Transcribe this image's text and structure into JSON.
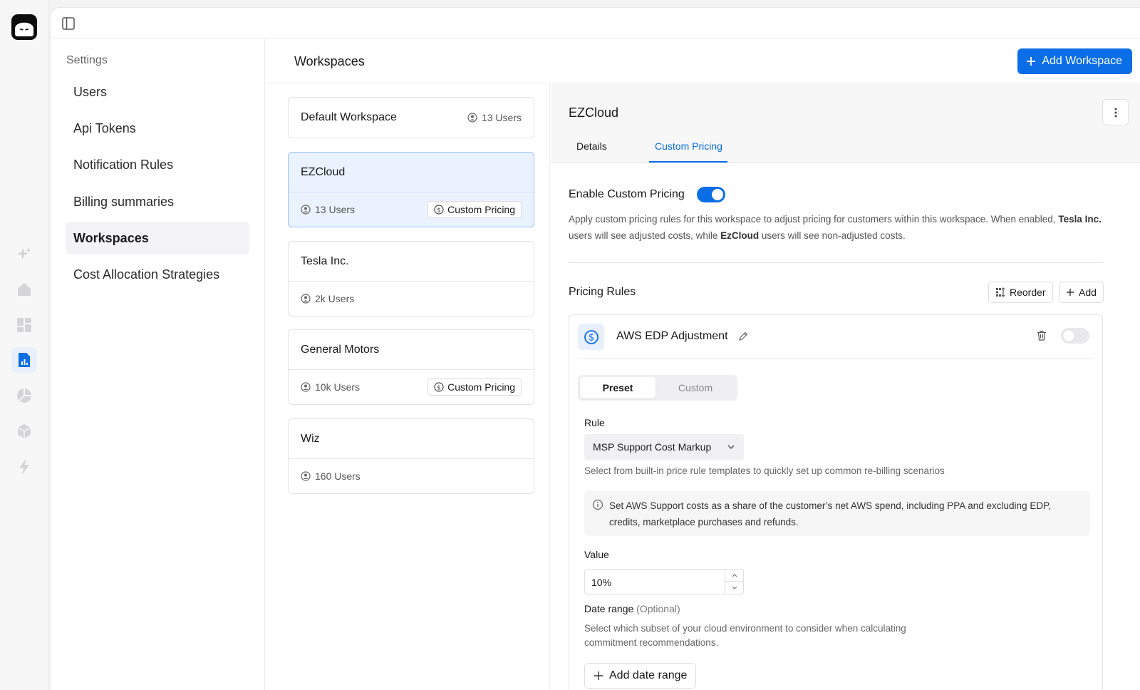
{
  "settings": {
    "title": "Settings",
    "items": [
      {
        "label": "Users"
      },
      {
        "label": "Api Tokens"
      },
      {
        "label": "Notification Rules"
      },
      {
        "label": "Billing summaries"
      },
      {
        "label": "Workspaces",
        "active": true
      },
      {
        "label": "Cost Allocation Strategies"
      }
    ]
  },
  "header": {
    "title": "Workspaces",
    "add_button": "Add Workspace"
  },
  "workspaces": [
    {
      "name": "Default Workspace",
      "users": "13 Users"
    },
    {
      "name": "EZCloud",
      "users": "13 Users",
      "badge": "Custom Pricing",
      "selected": true
    },
    {
      "name": "Tesla Inc.",
      "users": "2k Users"
    },
    {
      "name": "General Motors",
      "users": "10k Users",
      "badge": "Custom Pricing"
    },
    {
      "name": "Wiz",
      "users": "160 Users"
    }
  ],
  "detail": {
    "name": "EZCloud",
    "tabs": [
      {
        "label": "Details"
      },
      {
        "label": "Custom Pricing",
        "active": true
      }
    ],
    "enable_label": "Enable Custom Pricing",
    "enable_on": true,
    "desc_1": "Apply custom pricing rules for this workspace to adjust pricing for customers within this workspace. When enabled,",
    "desc_company": "Tesla Inc.",
    "desc_2": " users will see adjusted costs, while ",
    "desc_workspace": "EzCloud",
    "desc_3": " users will see non-adjusted costs.",
    "rules_label": "Pricing Rules",
    "reorder_label": "Reorder",
    "add_label": "Add",
    "rule": {
      "name": "AWS EDP Adjustment",
      "enabled": false,
      "seg": {
        "preset": "Preset",
        "custom": "Custom"
      },
      "rule_label": "Rule",
      "rule_value": "MSP Support Cost Markup",
      "rule_helper": "Select from built-in price rule templates to quickly set up common re-billing scenarios",
      "info": "Set AWS Support costs as a share of the customer’s net AWS spend, including PPA and excluding EDP, credits, marketplace purchases and refunds.",
      "value_label": "Value",
      "value": "10%",
      "date_label": "Date range",
      "date_optional": "(Optional)",
      "date_helper": "Select which subset of your cloud environment to consider when calculating commitment recommendations.",
      "add_range": "Add date range"
    }
  },
  "colors": {
    "accent": "#0b6ee6",
    "selected_bg": "#eaf2fe"
  }
}
